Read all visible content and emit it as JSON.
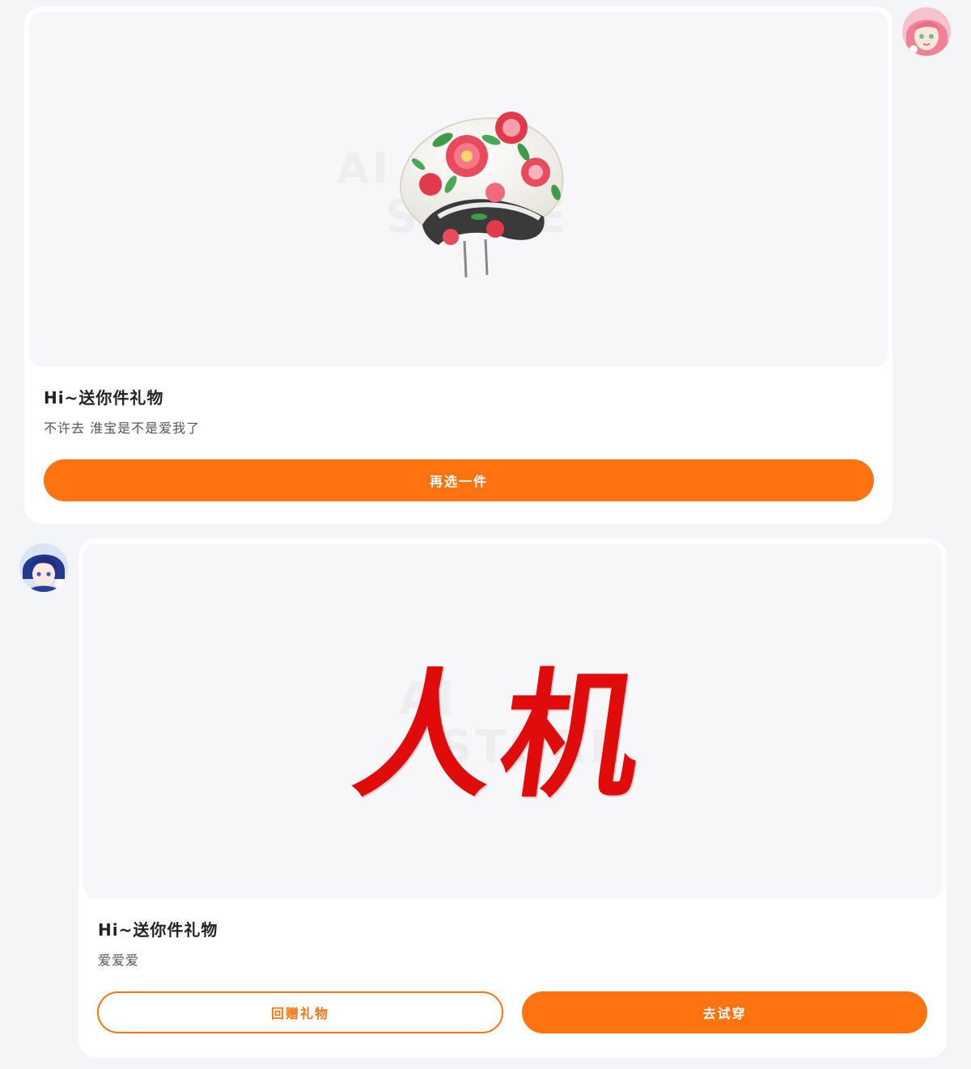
{
  "messages": [
    {
      "sender": "other",
      "avatar_icon": "anime-girl-avatar-icon",
      "gift_image_icon": "floral-headband-icon",
      "title": "Hi~送你件礼物",
      "message": "不许去 淮宝是不是爱我了",
      "buttons": {
        "primary": "再选一件"
      }
    },
    {
      "sender": "self",
      "avatar_icon": "anime-boy-avatar-icon",
      "gift_image_icon": "calligraphy-text-image",
      "gift_image_text": "人机",
      "title": "Hi~送你件礼物",
      "message": "爱爱爱",
      "buttons": {
        "secondary": "回赠礼物",
        "primary": "去试穿"
      }
    }
  ],
  "colors": {
    "accent": "#ff7410",
    "background": "#f4f5f7",
    "card": "#ffffff",
    "calligraphy": "#e00c0c"
  }
}
